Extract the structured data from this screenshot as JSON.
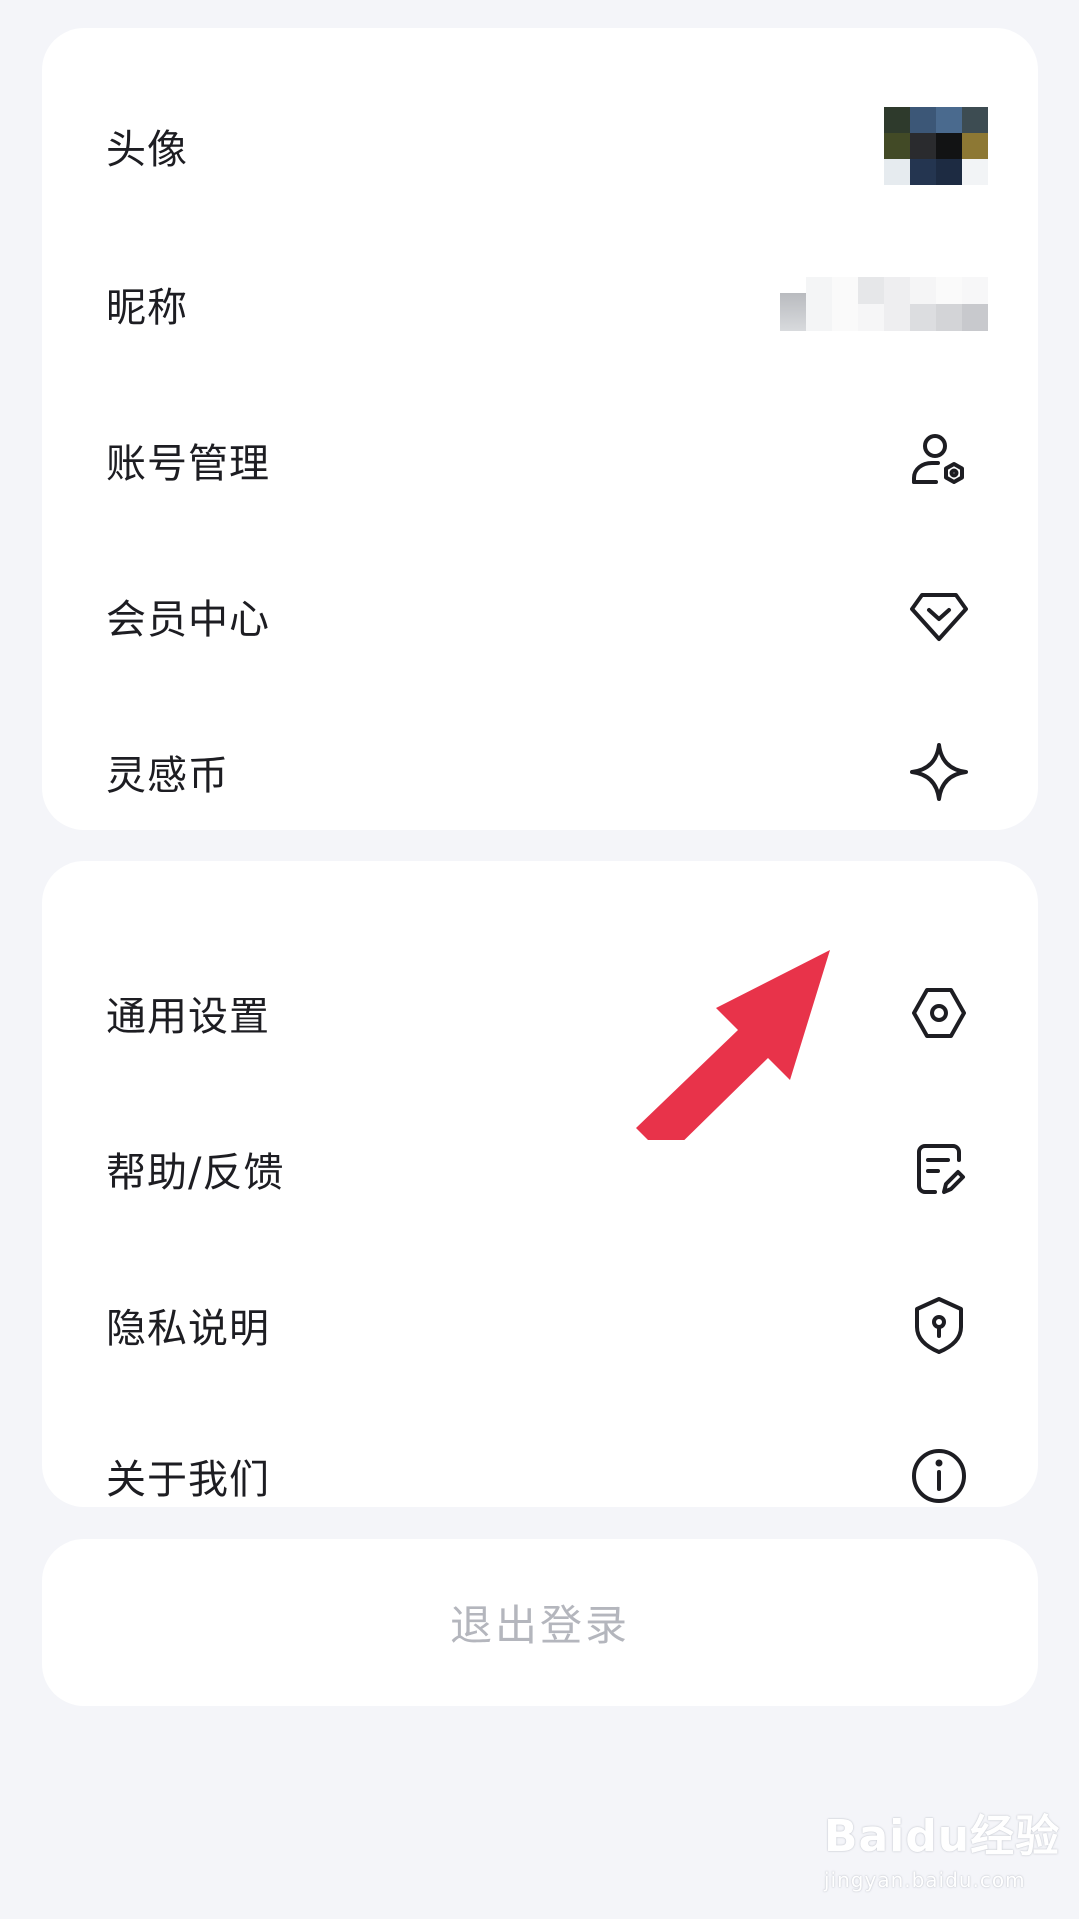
{
  "profile_section": {
    "avatar_label": "头像",
    "nickname_label": "昵称",
    "account_label": "账号管理",
    "account_icon": "user-gear-icon",
    "member_label": "会员中心",
    "member_icon": "diamond-icon",
    "coins_label": "灵感币",
    "coins_icon": "sparkle-icon"
  },
  "settings_section": {
    "general_label": "通用设置",
    "general_icon": "hexagon-settings-icon",
    "help_label": "帮助/反馈",
    "help_icon": "feedback-edit-icon",
    "privacy_label": "隐私说明",
    "privacy_icon": "shield-keyhole-icon",
    "about_label": "关于我们",
    "about_icon": "info-icon"
  },
  "logout_label": "退出登录",
  "watermark": {
    "main": "Baidu经验",
    "sub": "jingyan.baidu.com"
  },
  "colors": {
    "background": "#f4f5f9",
    "card": "#ffffff",
    "text": "#1d1d22",
    "logout_text": "#b4b6bd",
    "arrow": "#e8334a"
  }
}
